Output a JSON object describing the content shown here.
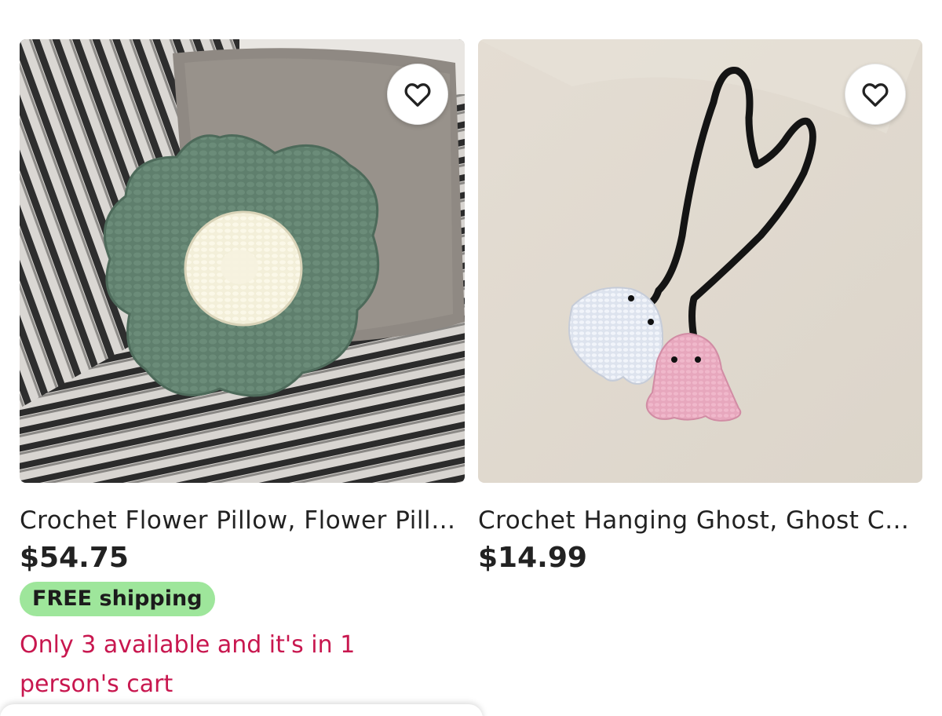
{
  "listings": [
    {
      "title": "Crochet Flower Pillow, Flower Pillow, Crochet Pillow",
      "price": "$54.75",
      "shipping_badge": "FREE shipping",
      "stock_notice": "Only 3 available and it's in 1 person's cart",
      "favorite_icon": "heart-outline-icon"
    },
    {
      "title": "Crochet Hanging Ghost, Ghost Car Charm",
      "price": "$14.99",
      "favorite_icon": "heart-outline-icon"
    }
  ],
  "colors": {
    "badge_bg": "#9ee69b",
    "stock_text": "#c8174f",
    "text": "#222222"
  }
}
